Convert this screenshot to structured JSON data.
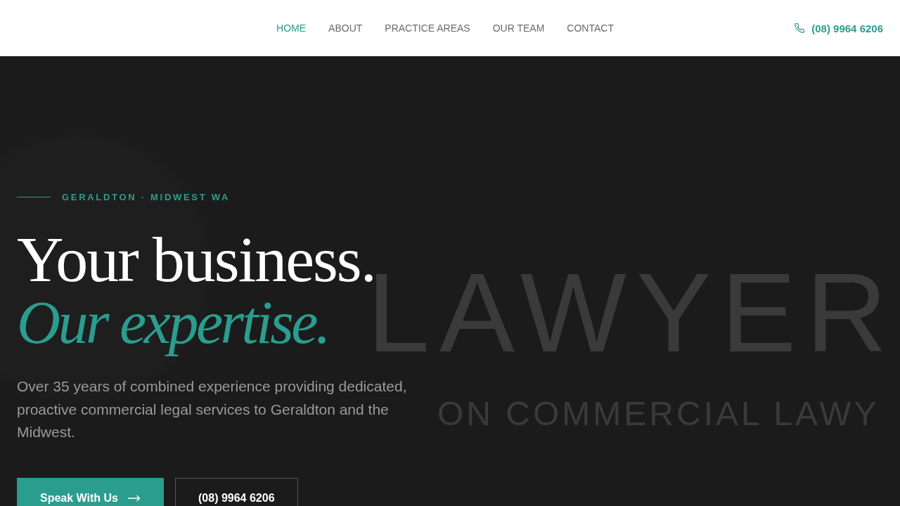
{
  "header": {
    "nav": [
      {
        "label": "HOME",
        "selected": true
      },
      {
        "label": "ABOUT",
        "selected": false
      },
      {
        "label": "PRACTICE AREAS",
        "selected": false
      },
      {
        "label": "OUR TEAM",
        "selected": false
      },
      {
        "label": "CONTACT",
        "selected": false
      }
    ],
    "phone": "(08) 9964 6206"
  },
  "hero": {
    "backdrop": {
      "word": "LAWYER",
      "tagline": "ON COMMERCIAL LAWY"
    },
    "eyebrow": "GERALDTON · MIDWEST WA",
    "headline": "Your business.",
    "headline_accent": "Our expertise.",
    "intro": "Over 35 years of combined experience providing dedicated, proactive commercial legal services to Geraldton and the Midwest.",
    "buttons": [
      {
        "label": "Speak With Us",
        "kind": "primary"
      },
      {
        "label": "(08) 9964 6206",
        "kind": "outline"
      }
    ]
  }
}
